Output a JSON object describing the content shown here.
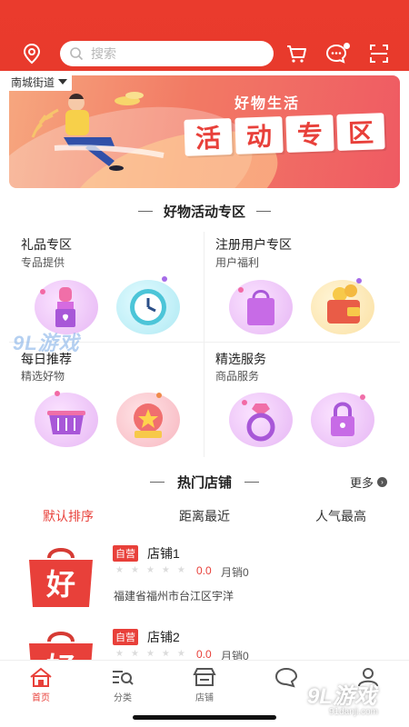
{
  "header": {
    "search_placeholder": "搜索",
    "location": "南城街道"
  },
  "banner": {
    "subtitle": "好物生活",
    "title_chars": [
      "活",
      "动",
      "专",
      "区"
    ]
  },
  "activity_section": {
    "title": "好物活动专区",
    "cells": [
      {
        "title": "礼品专区",
        "subtitle": "专品提供"
      },
      {
        "title": "注册用户专区",
        "subtitle": "用户福利"
      },
      {
        "title": "每日推荐",
        "subtitle": "精选好物"
      },
      {
        "title": "精选服务",
        "subtitle": "商品服务"
      }
    ]
  },
  "watermark": {
    "top_text": "9L游戏",
    "bottom_text": "9L游戏",
    "bottom_sub": "91danji.com"
  },
  "hot_shops": {
    "title": "热门店铺",
    "more_label": "更多",
    "sort_options": [
      "默认排序",
      "距离最近",
      "人气最高"
    ],
    "shops": [
      {
        "badge": "自营",
        "name": "店铺1",
        "score": "0.0",
        "sales": "月销0",
        "address": "福建省福州市台江区宇洋",
        "logo_char": "好"
      },
      {
        "badge": "自营",
        "name": "店铺2",
        "score": "0.0",
        "sales": "月销0",
        "address": "",
        "logo_char": "好"
      }
    ]
  },
  "tabbar": {
    "tabs": [
      {
        "label": "首页",
        "icon": "home-icon"
      },
      {
        "label": "分类",
        "icon": "category-search-icon"
      },
      {
        "label": "店铺",
        "icon": "shop-icon"
      },
      {
        "label": "",
        "icon": "chat-icon"
      },
      {
        "label": "",
        "icon": "user-icon"
      }
    ]
  },
  "colors": {
    "brand_red": "#e8403a",
    "header_red": "#ea3b2d"
  }
}
